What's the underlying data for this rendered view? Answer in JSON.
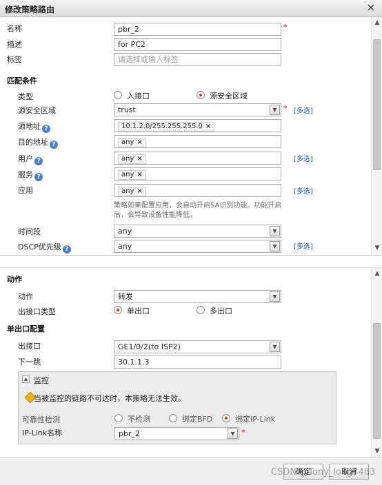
{
  "dialog": {
    "title": "修改策略路由",
    "close_icon": "×"
  },
  "basic": {
    "name_label": "名称",
    "name_value": "pbr_2",
    "desc_label": "描述",
    "desc_value": "for PC2",
    "tag_label": "标签",
    "tag_placeholder": "请选择或输入标签"
  },
  "match": {
    "section": "匹配条件",
    "type_label": "类型",
    "type_options": [
      "入接口",
      "源安全区域"
    ],
    "type_selected": "源安全区域",
    "src_zone_label": "源安全区域",
    "src_zone_value": "trust",
    "src_addr_label": "源地址",
    "src_addr_value": "10.1.2.0/255.255.255.0",
    "dst_addr_label": "目的地址",
    "dst_addr_value": "any",
    "user_label": "用户",
    "user_value": "any",
    "service_label": "服务",
    "service_value": "any",
    "app_label": "应用",
    "app_value": "any",
    "app_note_1": "策略如果配置应用，会自动开启SA识别功能。功能开启",
    "app_note_2": "后，会导致设备性能降低。",
    "time_label": "时间段",
    "time_value": "any",
    "dscp_label": "DSCP优先级",
    "dscp_value": "any",
    "more_label": "[多选]",
    "help_glyph": "?"
  },
  "action": {
    "section": "动作",
    "action_label": "动作",
    "action_value": "转发",
    "out_type_label": "出接口类型",
    "out_type_options": [
      "单出口",
      "多出口"
    ],
    "out_type_selected": "单出口"
  },
  "single_out": {
    "section": "单出口配置",
    "out_if_label": "出接口",
    "out_if_value": "GE1/0/2(to ISP2)",
    "next_hop_label": "下一跳",
    "next_hop_value": "30.1.1.3"
  },
  "monitor": {
    "toggle_glyph": "▲",
    "title": "监控",
    "warning": "当被监控的链路不可达时，本策略无法生效。",
    "reliability_label": "可靠性检测",
    "reliability_options": [
      "不检测",
      "绑定BFD",
      "绑定IP-Link"
    ],
    "reliability_selected": "绑定IP-Link",
    "iplink_label": "IP-Link名称",
    "iplink_value": "pbr_2"
  },
  "footer": {
    "ok_label": "确定",
    "cancel_label": "取消"
  },
  "watermark": "CSDN @Tony_long7483",
  "icons": {
    "dropdown": "chevron-down-icon",
    "close": "close-icon",
    "help": "help-icon",
    "warning": "warning-icon"
  },
  "colors": {
    "required": "#dd0000",
    "link": "#1a4fa8",
    "radio_selected": "#c0392b",
    "help_icon": "#4a7fc8"
  }
}
